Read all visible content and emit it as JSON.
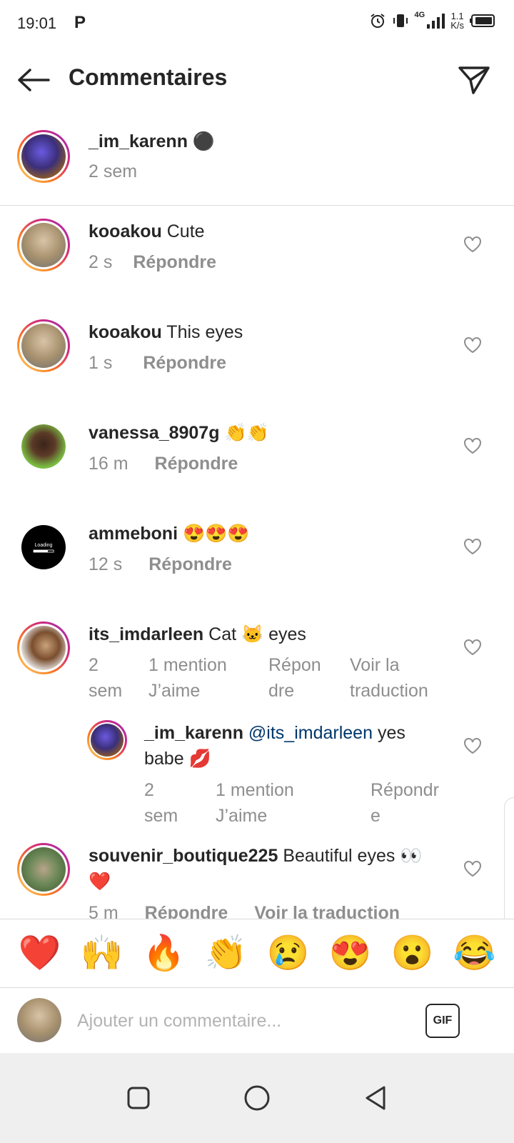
{
  "status": {
    "time": "19:01",
    "p_icon": "P",
    "network": "4G",
    "speed_value": "1.1",
    "speed_unit": "K/s"
  },
  "header": {
    "title": "Commentaires"
  },
  "caption": {
    "username": "_im_karenn",
    "emoji": "⚫",
    "time": "2 sem"
  },
  "comments": [
    {
      "username": "kooakou",
      "text": "Cute",
      "time": "2 s",
      "reply": "Répondre"
    },
    {
      "username": "kooakou",
      "text": "This eyes",
      "time": "1 s",
      "reply": "Répondre"
    },
    {
      "username": "vanessa_8907g",
      "text": "👏👏",
      "time": "16 m",
      "reply": "Répondre"
    },
    {
      "username": "ammeboni",
      "text": "😍😍😍",
      "time": "12 s",
      "reply": "Répondre"
    },
    {
      "username": "its_imdarleen",
      "text": "Cat 🐱 eyes",
      "time_line1": "2",
      "time_line2": "sem",
      "likes_line1": "1 mention",
      "likes_line2": "J’aime",
      "reply_line1": "Répon",
      "reply_line2": "dre",
      "translate_line1": "Voir la",
      "translate_line2": "traduction"
    },
    {
      "username": "_im_karenn",
      "mention": "@its_imdarleen",
      "text_line1": "yes",
      "text_line2": "babe 💋",
      "time_line1": "2",
      "time_line2": "sem",
      "likes_line1": "1 mention",
      "likes_line2": "J’aime",
      "reply_line1": "Répondr",
      "reply_line2": "e"
    },
    {
      "username": "souvenir_boutique225",
      "text": "Beautiful eyes 👀",
      "text_line2": "❤️",
      "time": "5 m",
      "reply": "Répondre",
      "translate": "Voir la traduction"
    }
  ],
  "emoji_bar": [
    "❤️",
    "🙌",
    "🔥",
    "👏",
    "😢",
    "😍",
    "😮",
    "😂"
  ],
  "input": {
    "placeholder": "Ajouter un commentaire...",
    "gif_label": "GIF"
  },
  "icons": {
    "back": "back-arrow-icon",
    "send": "send-icon",
    "heart": "heart-outline-icon",
    "nav_square": "recent-apps-icon",
    "nav_circle": "home-icon",
    "nav_triangle": "back-nav-icon"
  }
}
